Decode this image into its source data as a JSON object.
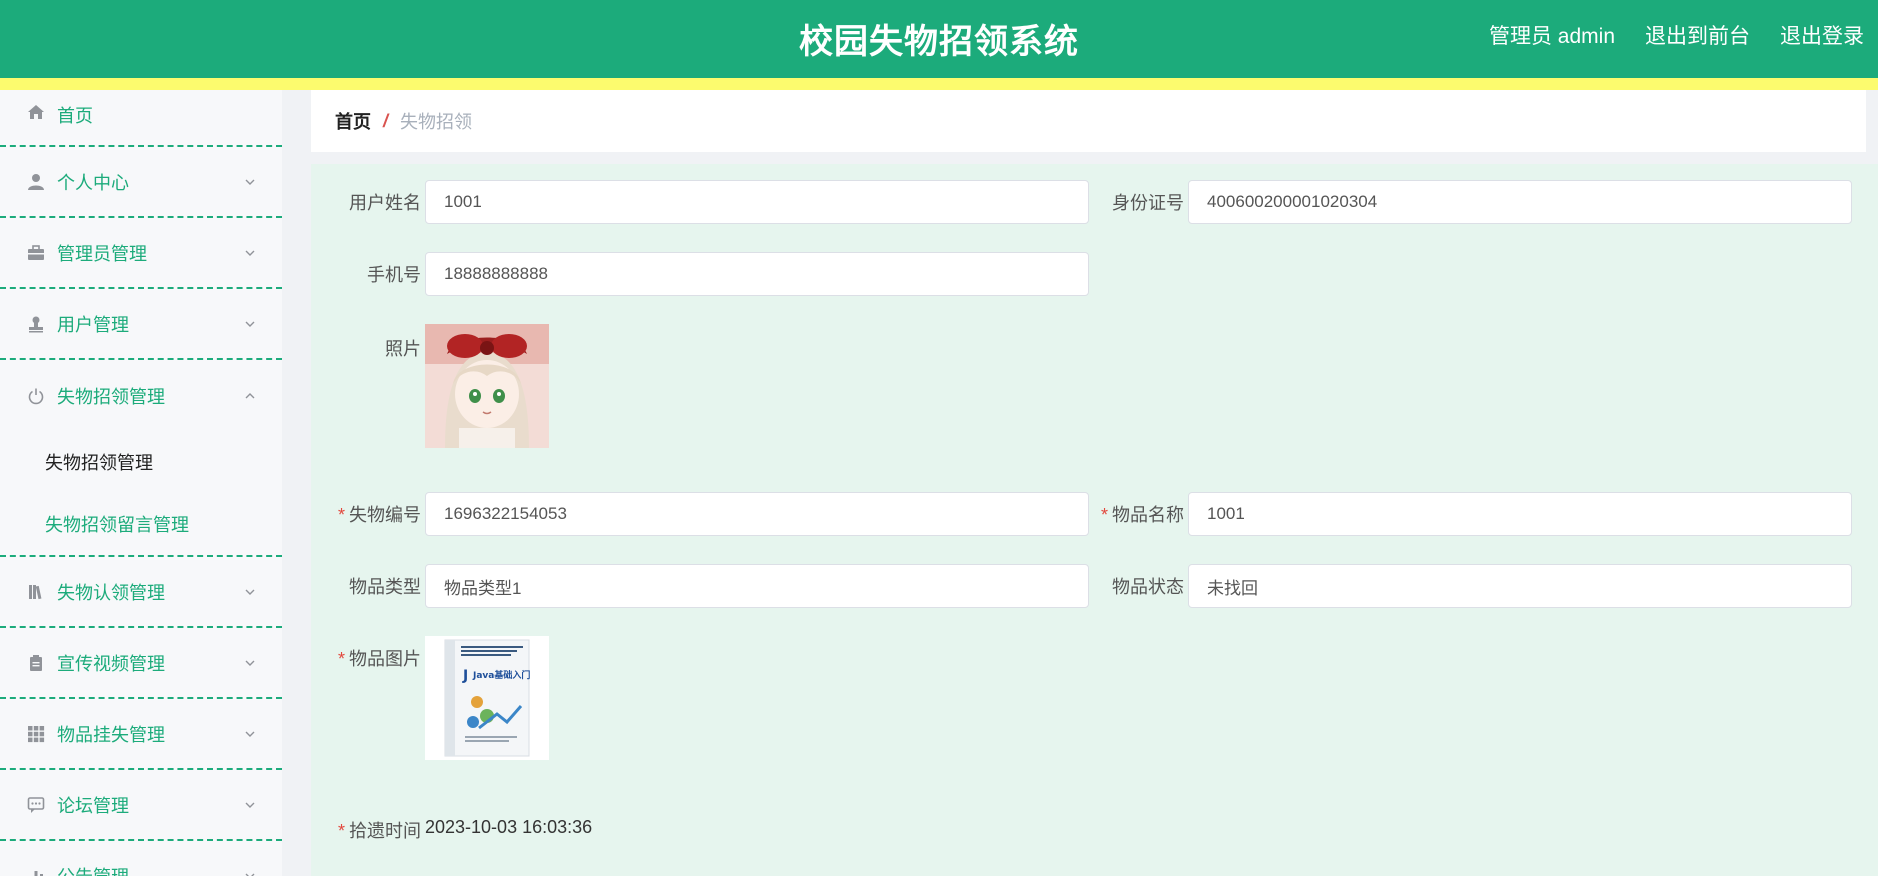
{
  "header": {
    "title": "校园失物招领系统",
    "user_label": "管理员 admin",
    "front_link": "退出到前台",
    "logout_link": "退出登录",
    "bg_color": "#1cab7b",
    "bar_color": "#fcfb6e"
  },
  "sidebar": {
    "items": [
      {
        "label": "首页",
        "icon": "home-icon"
      },
      {
        "label": "个人中心",
        "icon": "user-icon"
      },
      {
        "label": "管理员管理",
        "icon": "briefcase-icon"
      },
      {
        "label": "用户管理",
        "icon": "stamp-icon"
      },
      {
        "label": "失物招领管理",
        "icon": "power-icon",
        "expanded": true,
        "children": [
          {
            "label": "失物招领管理",
            "active": true
          },
          {
            "label": "失物招领留言管理",
            "active": false
          }
        ]
      },
      {
        "label": "失物认领管理",
        "icon": "book-icon"
      },
      {
        "label": "宣传视频管理",
        "icon": "clipboard-icon"
      },
      {
        "label": "物品挂失管理",
        "icon": "grid-icon"
      },
      {
        "label": "论坛管理",
        "icon": "chat-icon"
      },
      {
        "label": "公告管理",
        "icon": "chart-icon"
      }
    ]
  },
  "breadcrumb": {
    "home": "首页",
    "separator": "/",
    "current": "失物招领"
  },
  "form": {
    "username_label": "用户姓名",
    "username_value": "1001",
    "idcard_label": "身份证号",
    "idcard_value": "400600200001020304",
    "phone_label": "手机号",
    "phone_value": "18888888888",
    "photo_label": "照片",
    "lost_no_label": "失物编号",
    "lost_no_value": "1696322154053",
    "item_name_label": "物品名称",
    "item_name_value": "1001",
    "item_type_label": "物品类型",
    "item_type_value": "物品类型1",
    "item_status_label": "物品状态",
    "item_status_value": "未找回",
    "item_image_label": "物品图片",
    "book_title": "Java基础入门",
    "pickup_time_label": "拾遗时间",
    "pickup_time_value": "2023-10-03 16:03:36",
    "required_mark": "*"
  }
}
